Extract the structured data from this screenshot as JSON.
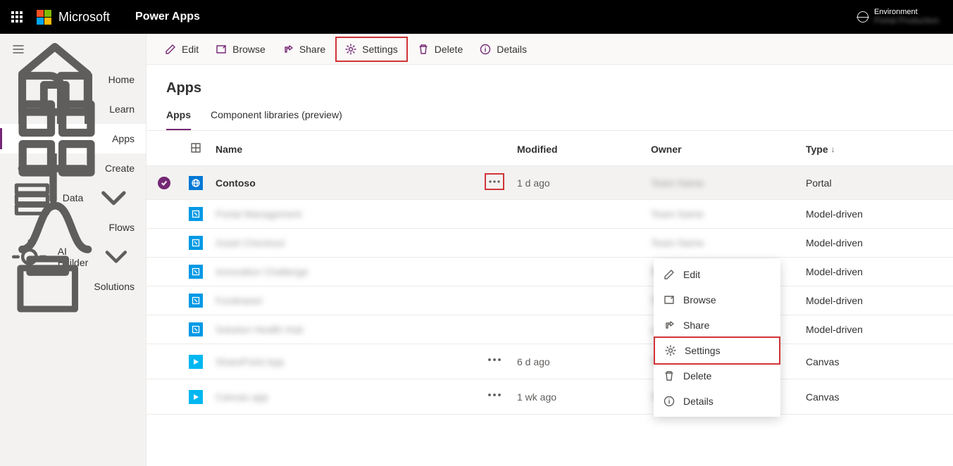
{
  "header": {
    "brand": "Microsoft",
    "app_name": "Power Apps",
    "env_label": "Environment",
    "env_name": "Portal Production"
  },
  "sidebar": {
    "items": [
      {
        "id": "home",
        "label": "Home"
      },
      {
        "id": "learn",
        "label": "Learn"
      },
      {
        "id": "apps",
        "label": "Apps"
      },
      {
        "id": "create",
        "label": "Create"
      },
      {
        "id": "data",
        "label": "Data",
        "chevron": true
      },
      {
        "id": "flows",
        "label": "Flows"
      },
      {
        "id": "aibuilder",
        "label": "AI Builder",
        "chevron": true
      },
      {
        "id": "solutions",
        "label": "Solutions"
      }
    ],
    "selected": "apps"
  },
  "commandbar": {
    "edit": "Edit",
    "browse": "Browse",
    "share": "Share",
    "settings": "Settings",
    "delete": "Delete",
    "details": "Details"
  },
  "page": {
    "title": "Apps",
    "tabs": [
      {
        "id": "apps",
        "label": "Apps"
      },
      {
        "id": "complibs",
        "label": "Component libraries (preview)"
      }
    ],
    "active_tab": "apps"
  },
  "table": {
    "columns": {
      "name": "Name",
      "modified": "Modified",
      "owner": "Owner",
      "type": "Type",
      "sort_indicator": "↓"
    },
    "rows": [
      {
        "name": "Contoso",
        "modified": "1 d ago",
        "owner": "Team Name",
        "type": "Portal",
        "icon": "portal",
        "selected": true,
        "show_menu_btn": true,
        "menu_hl": true,
        "blur_name": false
      },
      {
        "name": "Portal Management",
        "modified": "",
        "owner": "Team Name",
        "type": "Model-driven",
        "icon": "model",
        "selected": false,
        "show_menu_btn": false,
        "menu_hl": false,
        "blur_name": true
      },
      {
        "name": "Asset Checkout",
        "modified": "",
        "owner": "Team Name",
        "type": "Model-driven",
        "icon": "model",
        "selected": false,
        "show_menu_btn": false,
        "menu_hl": false,
        "blur_name": true
      },
      {
        "name": "Innovation Challenge",
        "modified": "",
        "owner": "Team Name",
        "type": "Model-driven",
        "icon": "model",
        "selected": false,
        "show_menu_btn": false,
        "menu_hl": false,
        "blur_name": true
      },
      {
        "name": "Fundraiser",
        "modified": "",
        "owner": "Team Name",
        "type": "Model-driven",
        "icon": "model",
        "selected": false,
        "show_menu_btn": false,
        "menu_hl": false,
        "blur_name": true
      },
      {
        "name": "Solution Health Hub",
        "modified": "",
        "owner": "u/Dev",
        "type": "Model-driven",
        "icon": "model",
        "selected": false,
        "show_menu_btn": false,
        "menu_hl": false,
        "blur_name": true
      },
      {
        "name": "SharePoint App",
        "modified": "6 d ago",
        "owner": "Team Name",
        "type": "Canvas",
        "icon": "canvas",
        "selected": false,
        "show_menu_btn": true,
        "menu_hl": false,
        "blur_name": true
      },
      {
        "name": "Canvas app",
        "modified": "1 wk ago",
        "owner": "Team Name",
        "type": "Canvas",
        "icon": "canvas",
        "selected": false,
        "show_menu_btn": true,
        "menu_hl": false,
        "blur_name": true
      }
    ]
  },
  "context_menu": {
    "edit": "Edit",
    "browse": "Browse",
    "share": "Share",
    "settings": "Settings",
    "delete": "Delete",
    "details": "Details"
  }
}
